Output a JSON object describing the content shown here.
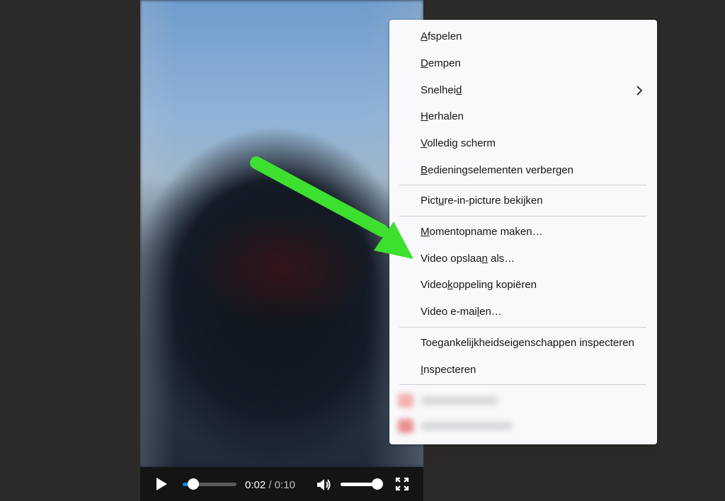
{
  "player": {
    "current_time": "0:02",
    "separator": "/",
    "duration": "0:10",
    "progress_fraction": 0.2,
    "volume_fraction": 1.0,
    "icons": [
      "play-icon",
      "volume-icon",
      "fullscreen-icon"
    ]
  },
  "context_menu": {
    "items": [
      {
        "pre": "",
        "u": "A",
        "post": "fspelen"
      },
      {
        "pre": "",
        "u": "D",
        "post": "empen"
      },
      {
        "pre": "Snelhei",
        "u": "d",
        "post": ""
      },
      {
        "pre": "",
        "u": "H",
        "post": "erhalen"
      },
      {
        "pre": "",
        "u": "V",
        "post": "olledig scherm"
      },
      {
        "pre": "",
        "u": "B",
        "post": "edieningselementen verbergen"
      },
      {
        "pre": "Pict",
        "u": "u",
        "post": "re-in-picture bekijken"
      },
      {
        "pre": "",
        "u": "M",
        "post": "omentopname maken…"
      },
      {
        "pre": "Video opslaa",
        "u": "n",
        "post": " als…"
      },
      {
        "pre": "Video",
        "u": "k",
        "post": "oppeling kopiëren"
      },
      {
        "pre": "Video e-mai",
        "u": "l",
        "post": "en…"
      },
      {
        "pre": "Toegankelijkheidseigenschappen inspecteren",
        "u": "",
        "post": ""
      },
      {
        "pre": "",
        "u": "I",
        "post": "nspecteren"
      }
    ]
  },
  "colors": {
    "arrow": "#3ee02f",
    "accent": "#0a84ff",
    "menu_bg": "#f9f9fb",
    "page_bg": "#2b2a29"
  }
}
